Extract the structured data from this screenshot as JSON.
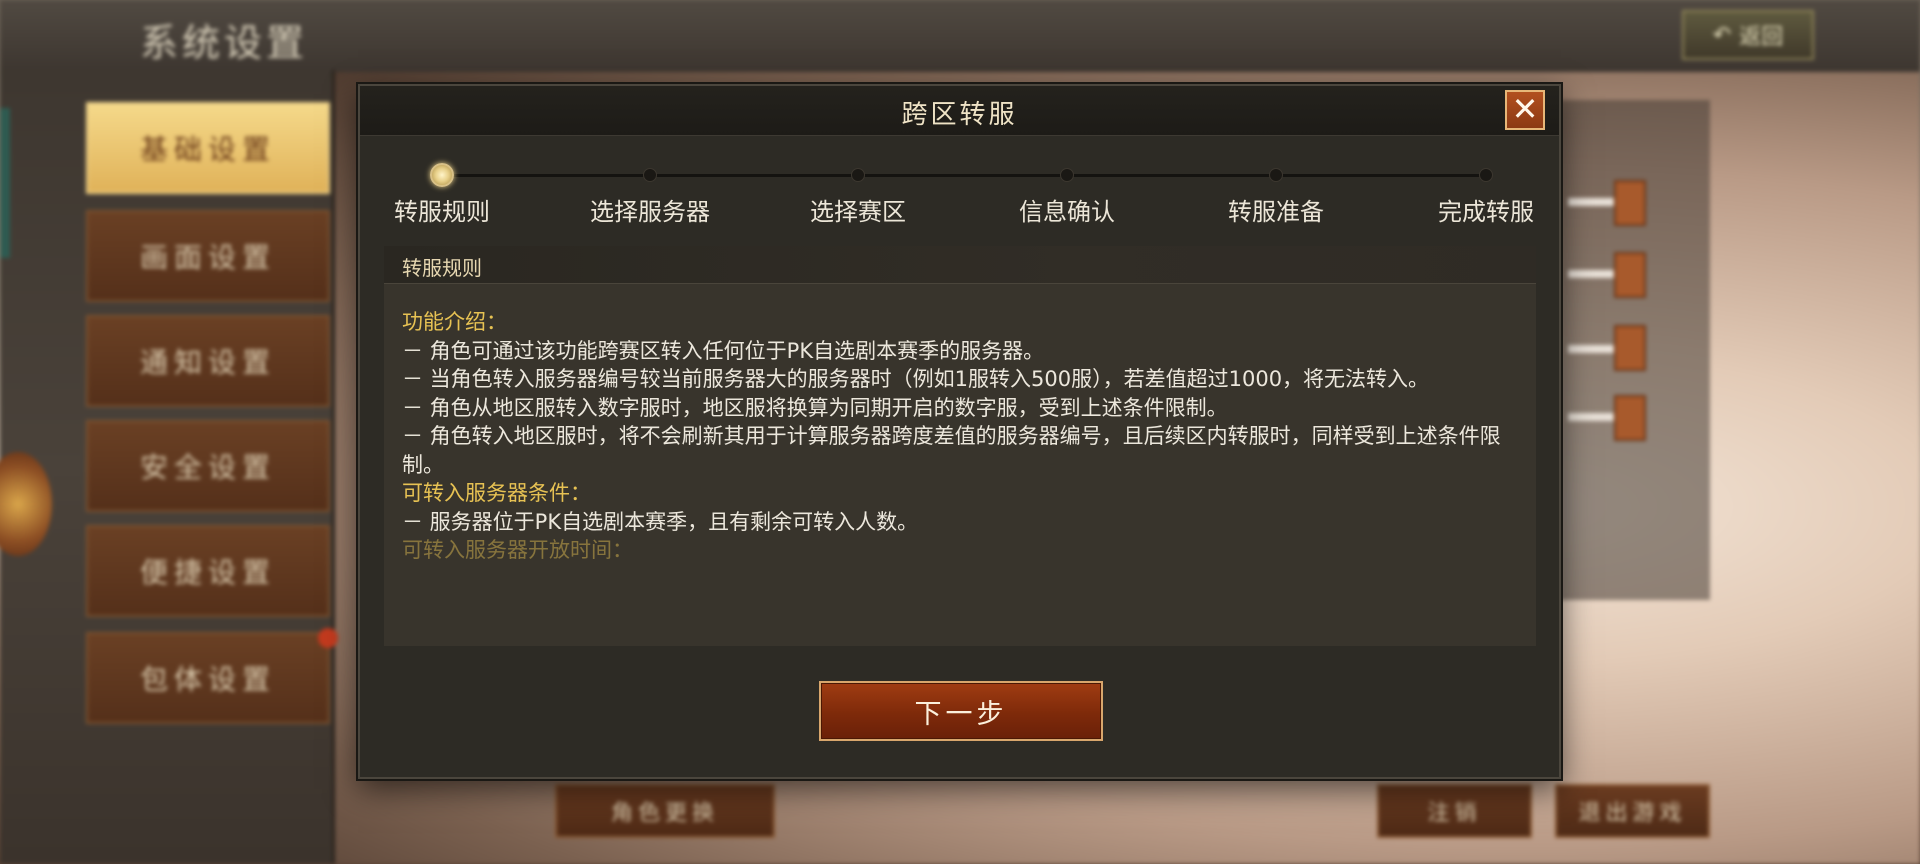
{
  "background": {
    "title": "系统设置",
    "back_label": "返回",
    "tabs": [
      {
        "label": "基础设置"
      },
      {
        "label": "画面设置"
      },
      {
        "label": "通知设置"
      },
      {
        "label": "安全设置"
      },
      {
        "label": "便捷设置"
      },
      {
        "label": "包体设置"
      }
    ],
    "bottom_buttons": [
      "角色更换",
      "注销",
      "退出游戏"
    ]
  },
  "dialog": {
    "title": "跨区转服",
    "close_glyph": "✕",
    "steps": [
      {
        "label": "转服规则",
        "active": true
      },
      {
        "label": "选择服务器",
        "active": false
      },
      {
        "label": "选择赛区",
        "active": false
      },
      {
        "label": "信息确认",
        "active": false
      },
      {
        "label": "转服准备",
        "active": false
      },
      {
        "label": "完成转服",
        "active": false
      }
    ],
    "panel_title": "转服规则",
    "content": [
      {
        "type": "heading",
        "text": "功能介绍："
      },
      {
        "type": "text",
        "text": "－ 角色可通过该功能跨赛区转入任何位于PK自选剧本赛季的服务器。"
      },
      {
        "type": "text",
        "text": "－ 当角色转入服务器编号较当前服务器大的服务器时（例如1服转入500服），若差值超过1000，将无法转入。"
      },
      {
        "type": "text",
        "text": "－ 角色从地区服转入数字服时，地区服将换算为同期开启的数字服，受到上述条件限制。"
      },
      {
        "type": "text",
        "text": "－ 角色转入地区服时，将不会刷新其用于计算服务器跨度差值的服务器编号，且后续区内转服时，同样受到上述条件限制。"
      },
      {
        "type": "heading",
        "text": "可转入服务器条件："
      },
      {
        "type": "text",
        "text": "－ 服务器位于PK自选剧本赛季，且有剩余可转入人数。"
      },
      {
        "type": "heading-fade",
        "text": "可转入服务器开放时间："
      }
    ],
    "next_button": "下一步"
  },
  "colors": {
    "accent_gold": "#e7c253",
    "button_red": "#8c2e0c",
    "close_orange": "#b2501f"
  }
}
